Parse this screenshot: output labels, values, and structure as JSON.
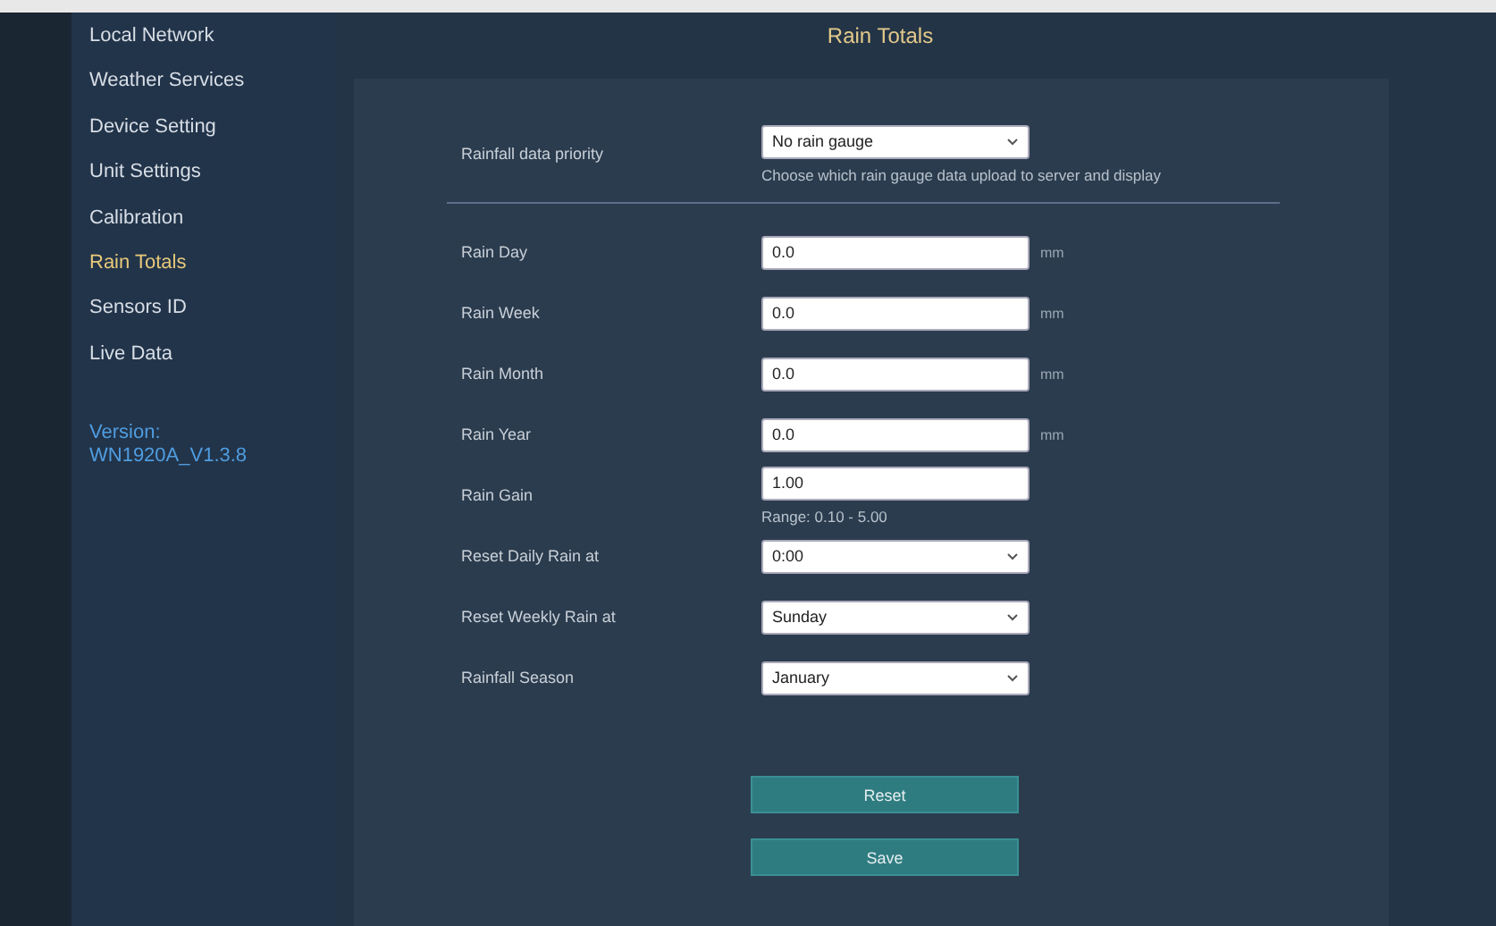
{
  "sidebar": {
    "items": [
      {
        "label": "Local Network",
        "selected": false
      },
      {
        "label": "Weather Services",
        "selected": false
      },
      {
        "label": "Device Setting",
        "selected": false
      },
      {
        "label": "Unit Settings",
        "selected": false
      },
      {
        "label": "Calibration",
        "selected": false
      },
      {
        "label": "Rain Totals",
        "selected": true
      },
      {
        "label": "Sensors ID",
        "selected": false
      },
      {
        "label": "Live Data",
        "selected": false
      }
    ],
    "version_label": "Version:",
    "version": "WN1920A_V1.3.8"
  },
  "page_title": "Rain Totals",
  "form": {
    "rows": [
      {
        "kind": "select",
        "label": "Rainfall data priority",
        "value": "No rain gauge",
        "hint": "Choose which rain gauge data upload to server and display"
      },
      {
        "kind": "divider"
      },
      {
        "kind": "input",
        "label": "Rain Day",
        "value": "0.0",
        "unit": "mm"
      },
      {
        "kind": "input",
        "label": "Rain Week",
        "value": "0.0",
        "unit": "mm"
      },
      {
        "kind": "input",
        "label": "Rain Month",
        "value": "0.0",
        "unit": "mm"
      },
      {
        "kind": "input",
        "label": "Rain Year",
        "value": "0.0",
        "unit": "mm"
      },
      {
        "kind": "input",
        "label": "Rain Gain",
        "value": "1.00",
        "hint": "Range: 0.10 - 5.00"
      },
      {
        "kind": "select",
        "label": "Reset Daily Rain at",
        "value": "0:00"
      },
      {
        "kind": "select",
        "label": "Reset Weekly Rain at",
        "value": "Sunday"
      },
      {
        "kind": "select",
        "label": "Rainfall Season",
        "value": "January"
      }
    ],
    "buttons": [
      "Reset",
      "Save"
    ]
  }
}
